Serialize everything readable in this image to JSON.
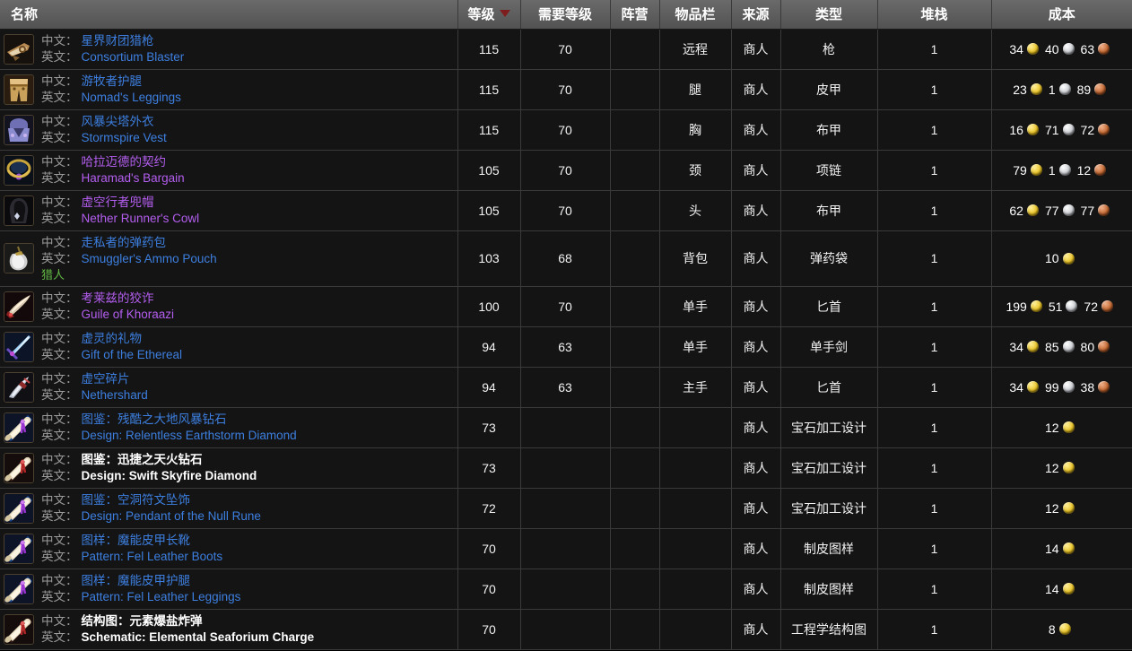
{
  "table": {
    "columns": [
      {
        "key": "name",
        "label": "名称",
        "sorted": false
      },
      {
        "key": "level",
        "label": "等级",
        "sorted": true
      },
      {
        "key": "reqlevel",
        "label": "需要等级",
        "sorted": false
      },
      {
        "key": "faction",
        "label": "阵营",
        "sorted": false
      },
      {
        "key": "slot",
        "label": "物品栏",
        "sorted": false
      },
      {
        "key": "source",
        "label": "来源",
        "sorted": false
      },
      {
        "key": "type",
        "label": "类型",
        "sorted": false
      },
      {
        "key": "stack",
        "label": "堆栈",
        "sorted": false
      },
      {
        "key": "cost",
        "label": "成本",
        "sorted": false
      }
    ],
    "labels": {
      "cn": "中文：",
      "en": "英文："
    },
    "rows": [
      {
        "icon": "gun-icon",
        "quality": "rare",
        "cn": "星界财团猎枪",
        "en": "Consortium Blaster",
        "classreq": "",
        "level": "115",
        "reqlevel": "70",
        "faction": "",
        "slot": "远程",
        "source": "商人",
        "type": "枪",
        "stack": "1",
        "cost": [
          {
            "amount": "34",
            "coin": "gold"
          },
          {
            "amount": "40",
            "coin": "silver"
          },
          {
            "amount": "63",
            "coin": "copper"
          }
        ]
      },
      {
        "icon": "leather-leggings-icon",
        "quality": "rare",
        "cn": "游牧者护腿",
        "en": "Nomad's Leggings",
        "classreq": "",
        "level": "115",
        "reqlevel": "70",
        "faction": "",
        "slot": "腿",
        "source": "商人",
        "type": "皮甲",
        "stack": "1",
        "cost": [
          {
            "amount": "23",
            "coin": "gold"
          },
          {
            "amount": "1",
            "coin": "silver"
          },
          {
            "amount": "89",
            "coin": "copper"
          }
        ]
      },
      {
        "icon": "cloth-vest-icon",
        "quality": "rare",
        "cn": "风暴尖塔外衣",
        "en": "Stormspire Vest",
        "classreq": "",
        "level": "115",
        "reqlevel": "70",
        "faction": "",
        "slot": "胸",
        "source": "商人",
        "type": "布甲",
        "stack": "1",
        "cost": [
          {
            "amount": "16",
            "coin": "gold"
          },
          {
            "amount": "71",
            "coin": "silver"
          },
          {
            "amount": "72",
            "coin": "copper"
          }
        ]
      },
      {
        "icon": "necklace-icon",
        "quality": "epic",
        "cn": "哈拉迈德的契约",
        "en": "Haramad's Bargain",
        "classreq": "",
        "level": "105",
        "reqlevel": "70",
        "faction": "",
        "slot": "颈",
        "source": "商人",
        "type": "项链",
        "stack": "1",
        "cost": [
          {
            "amount": "79",
            "coin": "gold"
          },
          {
            "amount": "1",
            "coin": "silver"
          },
          {
            "amount": "12",
            "coin": "copper"
          }
        ]
      },
      {
        "icon": "cowl-icon",
        "quality": "epic",
        "cn": "虚空行者兜帽",
        "en": "Nether Runner's Cowl",
        "classreq": "",
        "level": "105",
        "reqlevel": "70",
        "faction": "",
        "slot": "头",
        "source": "商人",
        "type": "布甲",
        "stack": "1",
        "cost": [
          {
            "amount": "62",
            "coin": "gold"
          },
          {
            "amount": "77",
            "coin": "silver"
          },
          {
            "amount": "77",
            "coin": "copper"
          }
        ]
      },
      {
        "icon": "ammo-pouch-icon",
        "quality": "rare",
        "cn": "走私者的弹药包",
        "en": "Smuggler's Ammo Pouch",
        "classreq": "猎人",
        "level": "103",
        "reqlevel": "68",
        "faction": "",
        "slot": "背包",
        "source": "商人",
        "type": "弹药袋",
        "stack": "1",
        "cost": [
          {
            "amount": "10",
            "coin": "gold"
          }
        ]
      },
      {
        "icon": "dagger-red-icon",
        "quality": "epic",
        "cn": "考莱兹的狡诈",
        "en": "Guile of Khoraazi",
        "classreq": "",
        "level": "100",
        "reqlevel": "70",
        "faction": "",
        "slot": "单手",
        "source": "商人",
        "type": "匕首",
        "stack": "1",
        "cost": [
          {
            "amount": "199",
            "coin": "gold"
          },
          {
            "amount": "51",
            "coin": "silver"
          },
          {
            "amount": "72",
            "coin": "copper"
          }
        ]
      },
      {
        "icon": "sword-blue-icon",
        "quality": "rare",
        "cn": "虚灵的礼物",
        "en": "Gift of the Ethereal",
        "classreq": "",
        "level": "94",
        "reqlevel": "63",
        "faction": "",
        "slot": "单手",
        "source": "商人",
        "type": "单手剑",
        "stack": "1",
        "cost": [
          {
            "amount": "34",
            "coin": "gold"
          },
          {
            "amount": "85",
            "coin": "silver"
          },
          {
            "amount": "80",
            "coin": "copper"
          }
        ]
      },
      {
        "icon": "shard-dagger-icon",
        "quality": "rare",
        "cn": "虚空碎片",
        "en": "Nethershard",
        "classreq": "",
        "level": "94",
        "reqlevel": "63",
        "faction": "",
        "slot": "主手",
        "source": "商人",
        "type": "匕首",
        "stack": "1",
        "cost": [
          {
            "amount": "34",
            "coin": "gold"
          },
          {
            "amount": "99",
            "coin": "silver"
          },
          {
            "amount": "38",
            "coin": "copper"
          }
        ]
      },
      {
        "icon": "scroll-purple-icon",
        "quality": "rare",
        "cn": "图鉴：残酷之大地风暴钻石",
        "en": "Design: Relentless Earthstorm Diamond",
        "classreq": "",
        "level": "73",
        "reqlevel": "",
        "faction": "",
        "slot": "",
        "source": "商人",
        "type": "宝石加工设计",
        "stack": "1",
        "cost": [
          {
            "amount": "12",
            "coin": "gold"
          }
        ]
      },
      {
        "icon": "scroll-red-icon",
        "quality": "white",
        "cn": "图鉴：迅捷之天火钻石",
        "en": "Design: Swift Skyfire Diamond",
        "classreq": "",
        "level": "73",
        "reqlevel": "",
        "faction": "",
        "slot": "",
        "source": "商人",
        "type": "宝石加工设计",
        "stack": "1",
        "cost": [
          {
            "amount": "12",
            "coin": "gold"
          }
        ]
      },
      {
        "icon": "scroll-purple-icon",
        "quality": "rare",
        "cn": "图鉴：空洞符文坠饰",
        "en": "Design: Pendant of the Null Rune",
        "classreq": "",
        "level": "72",
        "reqlevel": "",
        "faction": "",
        "slot": "",
        "source": "商人",
        "type": "宝石加工设计",
        "stack": "1",
        "cost": [
          {
            "amount": "12",
            "coin": "gold"
          }
        ]
      },
      {
        "icon": "scroll-purple-icon",
        "quality": "rare",
        "cn": "图样：魔能皮甲长靴",
        "en": "Pattern: Fel Leather Boots",
        "classreq": "",
        "level": "70",
        "reqlevel": "",
        "faction": "",
        "slot": "",
        "source": "商人",
        "type": "制皮图样",
        "stack": "1",
        "cost": [
          {
            "amount": "14",
            "coin": "gold"
          }
        ]
      },
      {
        "icon": "scroll-purple-icon",
        "quality": "rare",
        "cn": "图样：魔能皮甲护腿",
        "en": "Pattern: Fel Leather Leggings",
        "classreq": "",
        "level": "70",
        "reqlevel": "",
        "faction": "",
        "slot": "",
        "source": "商人",
        "type": "制皮图样",
        "stack": "1",
        "cost": [
          {
            "amount": "14",
            "coin": "gold"
          }
        ]
      },
      {
        "icon": "scroll-red-icon",
        "quality": "white",
        "cn": "结构图：元素爆盐炸弹",
        "en": "Schematic: Elemental Seaforium Charge",
        "classreq": "",
        "level": "70",
        "reqlevel": "",
        "faction": "",
        "slot": "",
        "source": "商人",
        "type": "工程学结构图",
        "stack": "1",
        "cost": [
          {
            "amount": "8",
            "coin": "gold"
          }
        ]
      }
    ]
  },
  "colors": {
    "rare": "#3d7fe0",
    "epic": "#b45ef0",
    "white": "#ffffff",
    "class_req": "#62b844",
    "sort_arrow": "#7d1d1d",
    "header_bg": "#5e5e5e",
    "row_bg": "#141414",
    "gridline": "#3a3a3a"
  }
}
